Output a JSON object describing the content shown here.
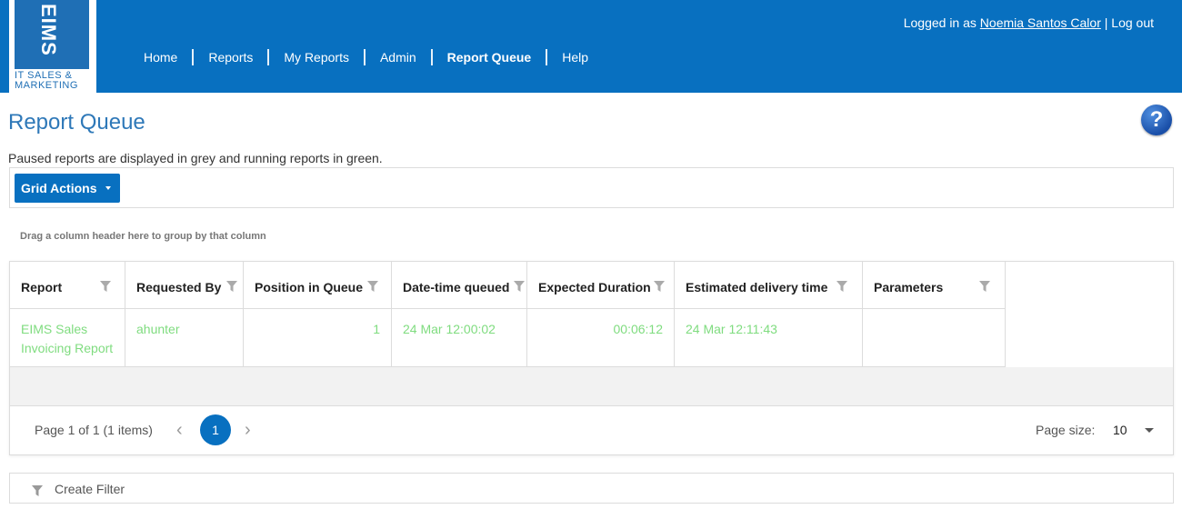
{
  "logo": {
    "brand": "EIMS",
    "line1": "IT SALES &",
    "line2": "MARKETING"
  },
  "nav": {
    "items": [
      {
        "label": "Home"
      },
      {
        "label": "Reports"
      },
      {
        "label": "My Reports"
      },
      {
        "label": "Admin"
      },
      {
        "label": "Report Queue",
        "active": true
      },
      {
        "label": "Help"
      }
    ]
  },
  "login": {
    "prefix": "Logged in as",
    "user": "Noemia Santos Calor",
    "separator": "|",
    "logout": "Log out"
  },
  "page": {
    "title": "Report Queue",
    "help_glyph": "?",
    "description": "Paused reports are displayed in grey and running reports in green."
  },
  "toolbar": {
    "grid_actions_label": "Grid Actions"
  },
  "grid": {
    "group_hint": "Drag a column header here to group by that column",
    "columns": [
      "Report",
      "Requested By",
      "Position in Queue",
      "Date-time queued",
      "Expected Duration",
      "Estimated delivery time",
      "Parameters"
    ],
    "rows": [
      {
        "report": "EIMS Sales Invoicing Report",
        "requested_by": "ahunter",
        "position": "1",
        "queued": "24 Mar 12:00:02",
        "duration": "00:06:12",
        "delivery": "24 Mar 12:11:43",
        "parameters": ""
      }
    ],
    "running_color": "#7fdc7f"
  },
  "pager": {
    "info": "Page 1 of 1 (1 items)",
    "current_page": "1",
    "page_size_label": "Page size:",
    "page_size_value": "10"
  },
  "filter": {
    "create_label": "Create Filter"
  },
  "colors": {
    "brand_blue": "#0870c0",
    "title_blue": "#2e78b8"
  }
}
